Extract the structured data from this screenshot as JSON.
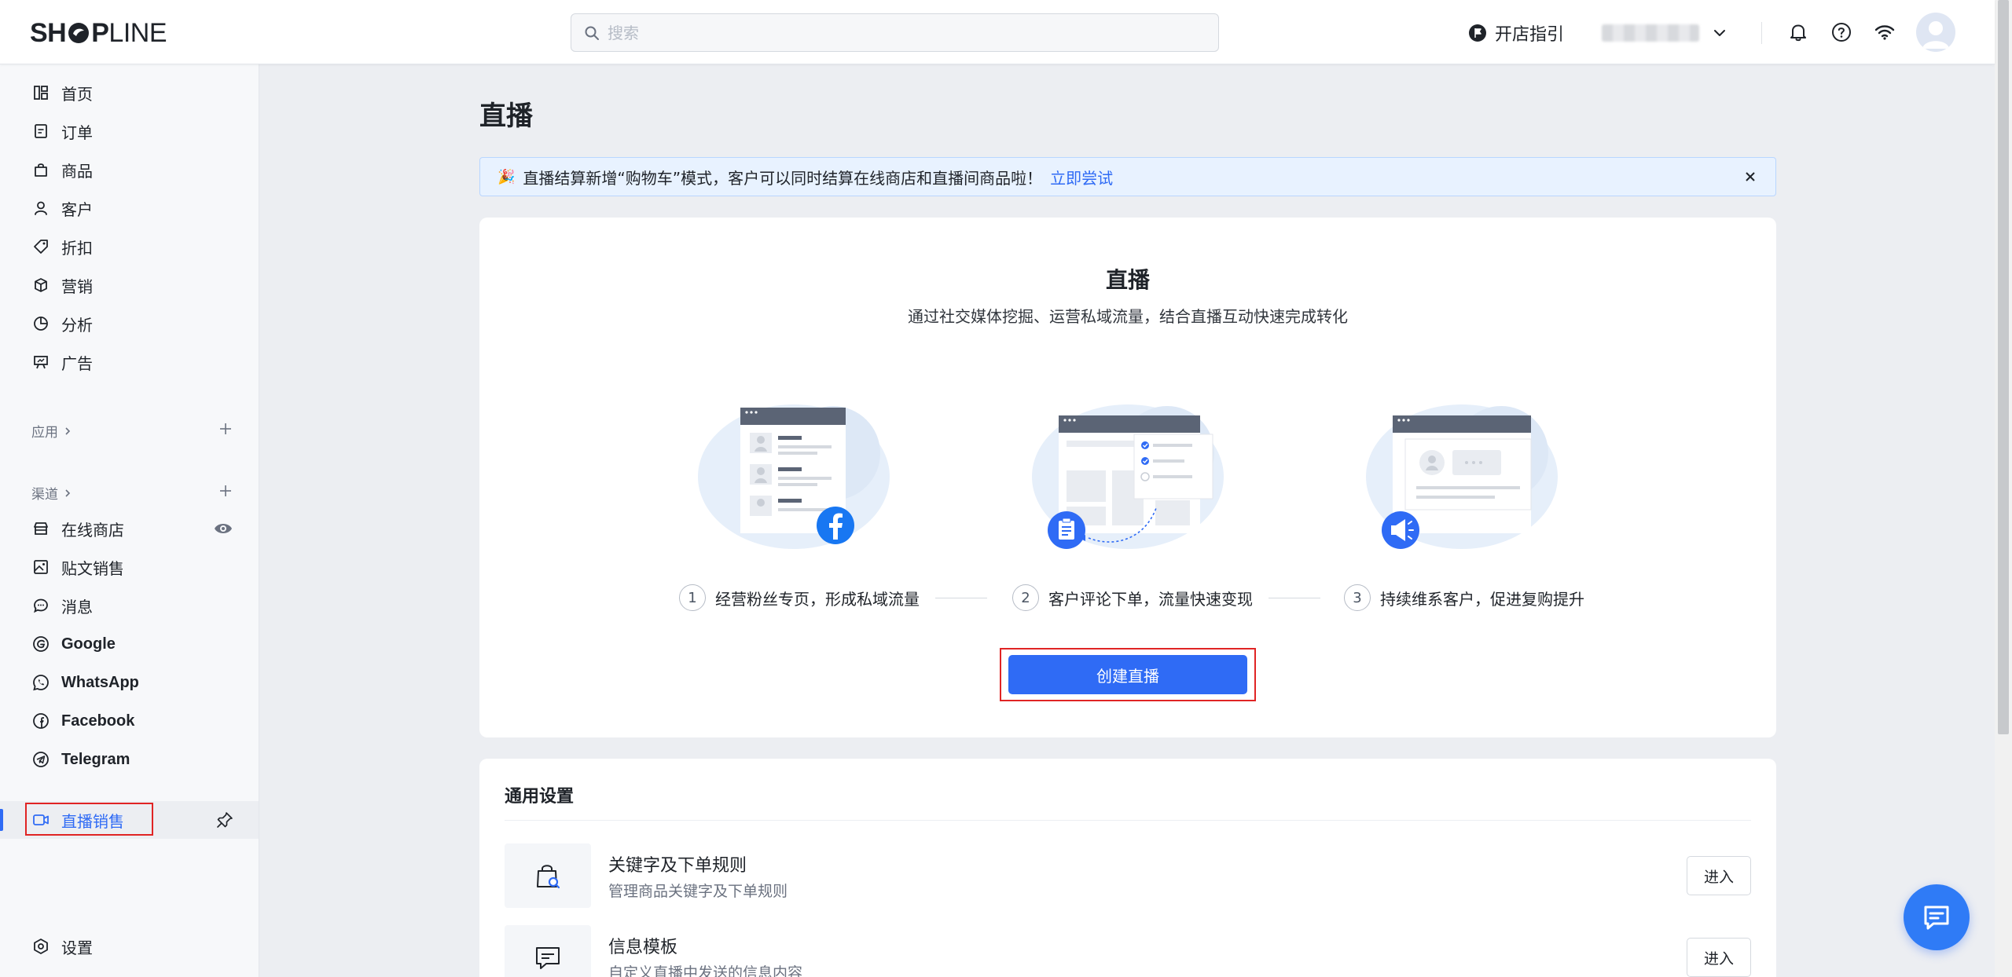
{
  "topbar": {
    "logo_bold": "SH",
    "logo_bold2": "P",
    "logo_light": "LINE",
    "search_placeholder": "搜索",
    "guide_label": "开店指引"
  },
  "sidebar": {
    "main_items": [
      {
        "label": "首页",
        "icon": "dashboard-icon"
      },
      {
        "label": "订单",
        "icon": "order-icon"
      },
      {
        "label": "商品",
        "icon": "bag-icon"
      },
      {
        "label": "客户",
        "icon": "user-icon"
      },
      {
        "label": "折扣",
        "icon": "tag-icon"
      },
      {
        "label": "营销",
        "icon": "cube-icon"
      },
      {
        "label": "分析",
        "icon": "pie-icon"
      },
      {
        "label": "广告",
        "icon": "billboard-icon"
      }
    ],
    "apps_label": "应用",
    "channels_label": "渠道",
    "channel_items": [
      {
        "label": "在线商店",
        "icon": "store-icon"
      },
      {
        "label": "贴文销售",
        "icon": "image-post-icon"
      },
      {
        "label": "消息",
        "icon": "message-icon"
      },
      {
        "label": "Google",
        "icon": "google-icon"
      },
      {
        "label": "WhatsApp",
        "icon": "whatsapp-icon"
      },
      {
        "label": "Facebook",
        "icon": "facebook-icon"
      },
      {
        "label": "Telegram",
        "icon": "telegram-icon"
      }
    ],
    "active_item": {
      "label": "直播销售",
      "icon": "live-video-icon"
    },
    "settings_label": "设置"
  },
  "main": {
    "page_title": "直播",
    "notice": {
      "text": "直播结算新增“购物车”模式，客户可以同时结算在线商店和直播间商品啦！",
      "link": "立即尝试"
    },
    "hero": {
      "title": "直播",
      "subtitle": "通过社交媒体挖掘、运营私域流量，结合直播互动快速完成转化",
      "steps": [
        {
          "num": "1",
          "text": "经营粉丝专页，形成私域流量"
        },
        {
          "num": "2",
          "text": "客户评论下单，流量快速变现"
        },
        {
          "num": "3",
          "text": "持续维系客户，促进复购提升"
        }
      ],
      "create_button": "创建直播"
    },
    "settings": {
      "title": "通用设置",
      "rows": [
        {
          "name": "关键字及下单规则",
          "desc": "管理商品关键字及下单规则",
          "button": "进入"
        },
        {
          "name": "信息模板",
          "desc": "自定义直播中发送的信息内容",
          "button": "进入"
        }
      ]
    }
  },
  "colors": {
    "primary": "#2f6bf5",
    "highlight_outline": "#e02424",
    "facebook": "#1877f2"
  }
}
